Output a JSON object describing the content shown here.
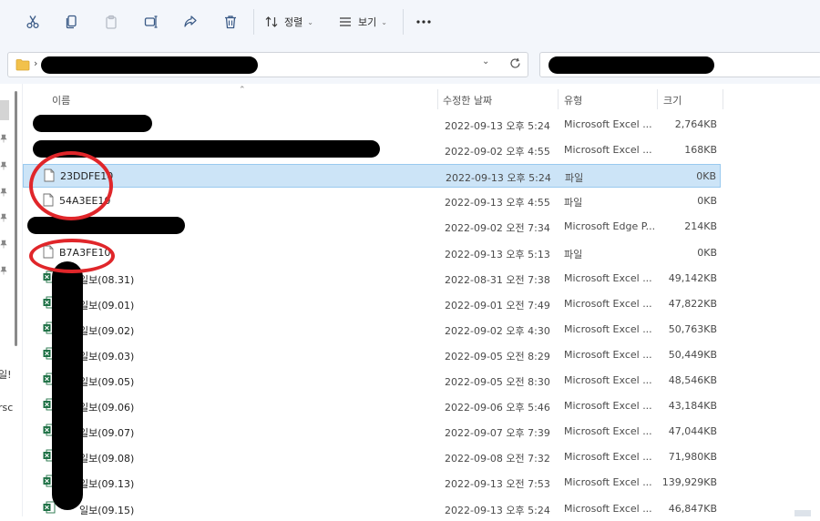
{
  "toolbar": {
    "sort_label": "정렬",
    "view_label": "보기"
  },
  "columns": {
    "name": "이름",
    "modified": "수정한 날짜",
    "type": "유형",
    "size": "크기"
  },
  "left_edge": [
    "일!",
    "rsc"
  ],
  "rows": [
    {
      "name": "",
      "date": "2022-09-13 오후 5:24",
      "type": "Microsoft Excel ...",
      "size": "2,764KB",
      "icon": "redacted"
    },
    {
      "name": "",
      "date": "2022-09-02 오후 4:55",
      "type": "Microsoft Excel ...",
      "size": "168KB",
      "icon": "redacted"
    },
    {
      "name": "23DDFE10",
      "date": "2022-09-13 오후 5:24",
      "type": "파일",
      "size": "0KB",
      "icon": "file-icon",
      "selected": true
    },
    {
      "name": "54A3EE10",
      "date": "2022-09-13 오후 4:55",
      "type": "파일",
      "size": "0KB",
      "icon": "file-icon"
    },
    {
      "name": "",
      "date": "2022-09-02 오전 7:34",
      "type": "Microsoft Edge P...",
      "size": "214KB",
      "icon": "redacted"
    },
    {
      "name": "B7A3FE10",
      "date": "2022-09-13 오후 5:13",
      "type": "파일",
      "size": "0KB",
      "icon": "file-icon"
    },
    {
      "name": "일보(08.31)",
      "date": "2022-08-31 오전 7:38",
      "type": "Microsoft Excel ...",
      "size": "49,142KB",
      "icon": "excel-icon"
    },
    {
      "name": "일보(09.01)",
      "date": "2022-09-01 오전 7:49",
      "type": "Microsoft Excel ...",
      "size": "47,822KB",
      "icon": "excel-icon"
    },
    {
      "name": "일보(09.02)",
      "date": "2022-09-02 오후 4:30",
      "type": "Microsoft Excel ...",
      "size": "50,763KB",
      "icon": "excel-icon"
    },
    {
      "name": "일보(09.03)",
      "date": "2022-09-05 오전 8:29",
      "type": "Microsoft Excel ...",
      "size": "50,449KB",
      "icon": "excel-icon"
    },
    {
      "name": "일보(09.05)",
      "date": "2022-09-05 오전 8:30",
      "type": "Microsoft Excel ...",
      "size": "48,546KB",
      "icon": "excel-icon"
    },
    {
      "name": "일보(09.06)",
      "date": "2022-09-06 오후 5:46",
      "type": "Microsoft Excel ...",
      "size": "43,184KB",
      "icon": "excel-icon"
    },
    {
      "name": "일보(09.07)",
      "date": "2022-09-07 오후 7:39",
      "type": "Microsoft Excel ...",
      "size": "47,044KB",
      "icon": "excel-icon"
    },
    {
      "name": "일보(09.08)",
      "date": "2022-09-08 오전 7:32",
      "type": "Microsoft Excel ...",
      "size": "71,980KB",
      "icon": "excel-icon"
    },
    {
      "name": "일보(09.13)",
      "date": "2022-09-13 오전 7:53",
      "type": "Microsoft Excel ...",
      "size": "139,929KB",
      "icon": "excel-icon"
    },
    {
      "name": "일보(09.15)",
      "date": "2022-09-13 오후 5:24",
      "type": "Microsoft Excel ...",
      "size": "46,847KB",
      "icon": "excel-icon"
    }
  ],
  "colors": {
    "toolbar_bg": "#f3f6fb",
    "selection_bg": "#cce4f7",
    "selection_border": "#99c9ef",
    "annotation_red": "#e0262a",
    "excel_green": "#1d7044"
  }
}
